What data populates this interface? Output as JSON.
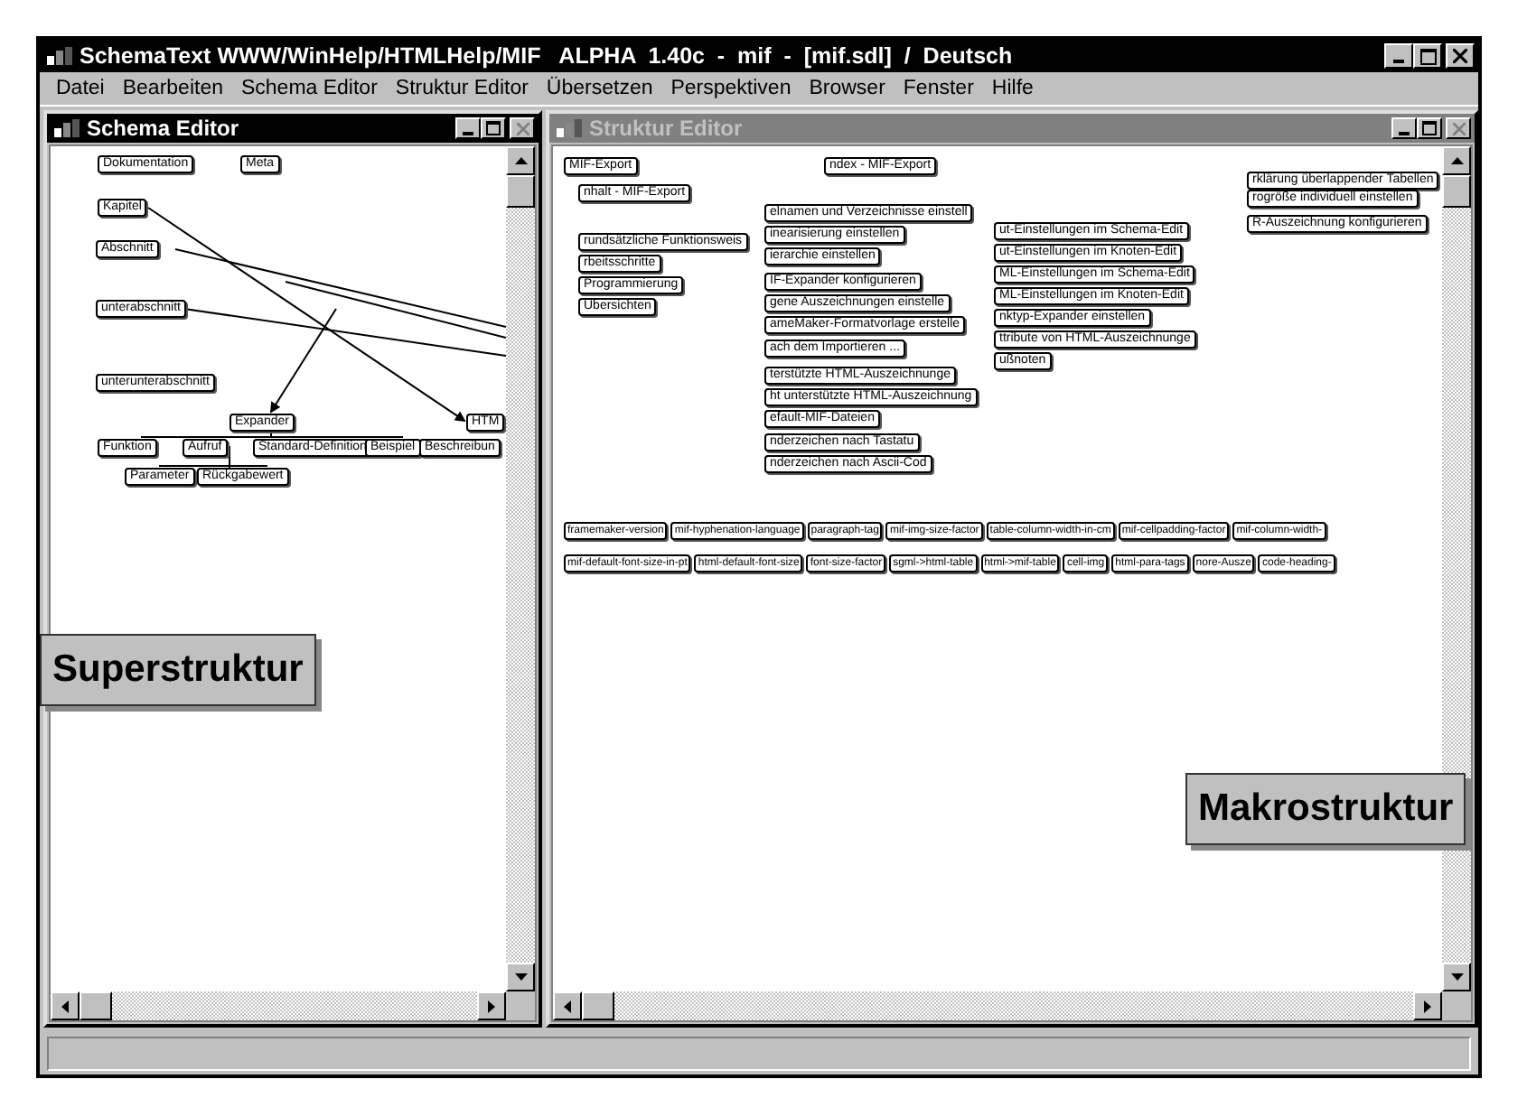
{
  "window": {
    "title": "SchemaText WWW/WinHelp/HTMLHelp/MIF   ALPHA  1.40c  -  mif  -  [mif.sdl]  /  Deutsch"
  },
  "menu": [
    "Datei",
    "Bearbeiten",
    "Schema Editor",
    "Struktur Editor",
    "Übersetzen",
    "Perspektiven",
    "Browser",
    "Fenster",
    "Hilfe"
  ],
  "schema_editor": {
    "title": "Schema Editor",
    "active": true,
    "nodes": [
      {
        "label": "Dokumentation"
      },
      {
        "label": "Meta"
      },
      {
        "label": "Kapitel"
      },
      {
        "label": "Abschnitt"
      },
      {
        "label": "unterabschnitt"
      },
      {
        "label": "unterunterabschnitt"
      },
      {
        "label": "Expander"
      },
      {
        "label": "Funktion"
      },
      {
        "label": "Aufruf"
      },
      {
        "label": "Standard-Definition"
      },
      {
        "label": "Beispiel"
      },
      {
        "label": "Parameter"
      },
      {
        "label": "Rückgabewert"
      },
      {
        "label": "HTM"
      },
      {
        "label": "Beschreibun"
      }
    ]
  },
  "struktur_editor": {
    "title": "Struktur Editor",
    "active": false,
    "nodes": [
      {
        "label": "MIF-Export"
      },
      {
        "label": "ndex - MIF-Export"
      },
      {
        "label": "nhalt - MIF-Export"
      },
      {
        "label": "rundsätzliche Funktionsweis"
      },
      {
        "label": "rbeitsschritte"
      },
      {
        "label": "Programmierung"
      },
      {
        "label": "Übersichten"
      },
      {
        "label": "elnamen und Verzeichnisse einstell"
      },
      {
        "label": "inearisierung einstellen"
      },
      {
        "label": "ierarchie einstellen"
      },
      {
        "label": "IF-Expander konfigurieren"
      },
      {
        "label": "gene Auszeichnungen einstelle"
      },
      {
        "label": "ameMaker-Formatvorlage erstelle"
      },
      {
        "label": "ach dem Importieren ..."
      },
      {
        "label": "terstützte HTML-Auszeichnunge"
      },
      {
        "label": "ht unterstützte HTML-Auszeichnung"
      },
      {
        "label": "efault-MIF-Dateien"
      },
      {
        "label": "nderzeichen nach Tastatu"
      },
      {
        "label": "nderzeichen nach Ascii-Cod"
      },
      {
        "label": "ut-Einstellungen im Schema-Edit"
      },
      {
        "label": "ut-Einstellungen im Knoten-Edit"
      },
      {
        "label": "ML-Einstellungen im Schema-Edit"
      },
      {
        "label": "ML-Einstellungen im Knoten-Edit"
      },
      {
        "label": "nktyp-Expander einstellen"
      },
      {
        "label": "ttribute von HTML-Auszeichnunge"
      },
      {
        "label": "ußnoten"
      },
      {
        "label": "rklärung überlappender Tabellen"
      },
      {
        "label": "rogröße individuell einstellen"
      },
      {
        "label": "R-Auszeichnung konfigurieren"
      },
      {
        "label": "framemaker-version"
      },
      {
        "label": "mif-hyphenation-language"
      },
      {
        "label": "paragraph-tag"
      },
      {
        "label": "mif-img-size-factor"
      },
      {
        "label": "table-column-width-in-cm"
      },
      {
        "label": "mif-cellpadding-factor"
      },
      {
        "label": "mif-column-width-"
      },
      {
        "label": "mif-default-font-size-in-pt"
      },
      {
        "label": "html-default-font-size"
      },
      {
        "label": "font-size-factor"
      },
      {
        "label": "sgml->html-table"
      },
      {
        "label": "html->mif-table"
      },
      {
        "label": "cell-img"
      },
      {
        "label": "html-para-tags"
      },
      {
        "label": "nore-Ausze"
      },
      {
        "label": "code-heading-"
      }
    ]
  },
  "annotations": [
    "Superstruktur",
    "Makrostruktur"
  ]
}
